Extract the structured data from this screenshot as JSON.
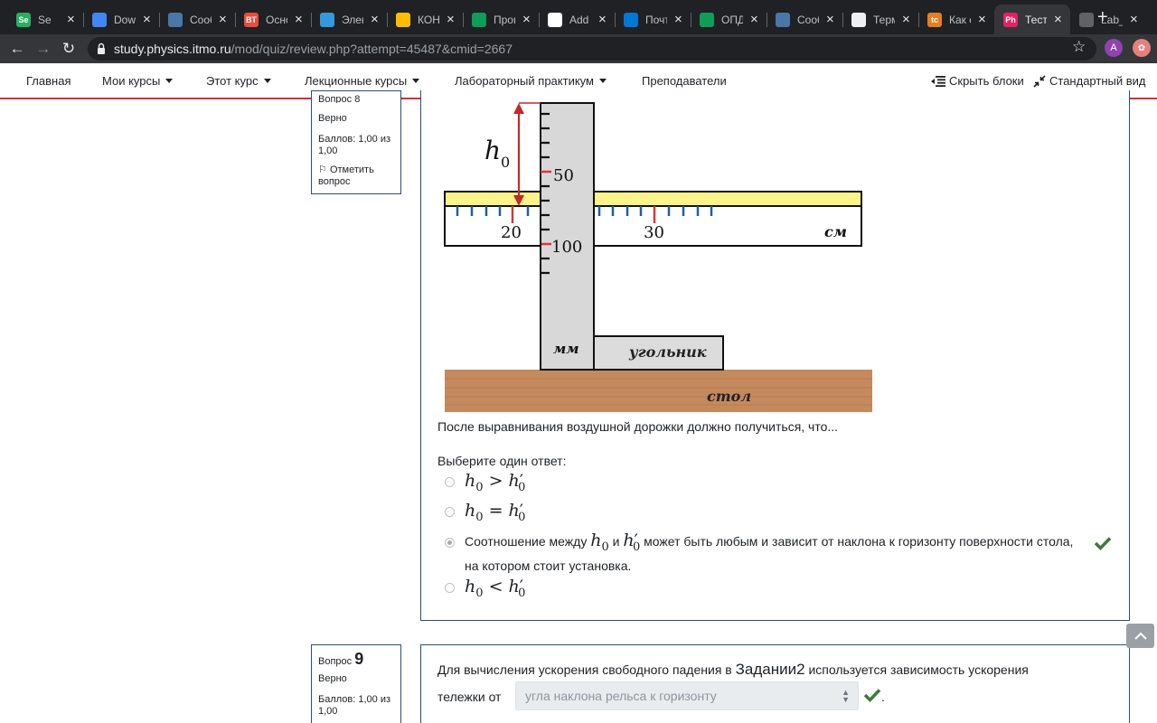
{
  "browser": {
    "tabs": [
      {
        "title": "Se",
        "favicon": "Se",
        "color": "#27ae60"
      },
      {
        "title": "Down",
        "favicon": "",
        "color": "#4285f4"
      },
      {
        "title": "Сооб",
        "favicon": "",
        "color": "#4a76a8"
      },
      {
        "title": "Осно",
        "favicon": "ВТ",
        "color": "#e74c3c"
      },
      {
        "title": "Элек",
        "favicon": "",
        "color": "#3498db"
      },
      {
        "title": "КОНС",
        "favicon": "",
        "color": "#fbbc04"
      },
      {
        "title": "Прог",
        "favicon": "",
        "color": "#0f9d58"
      },
      {
        "title": "Add F",
        "favicon": "",
        "color": "#ffffff"
      },
      {
        "title": "Почт",
        "favicon": "",
        "color": "#0078d4"
      },
      {
        "title": "ОПД",
        "favicon": "",
        "color": "#0f9d58"
      },
      {
        "title": "Сооб",
        "favicon": "",
        "color": "#4a76a8"
      },
      {
        "title": "Терм",
        "favicon": "",
        "color": "#ecf0f1"
      },
      {
        "title": "Как с",
        "favicon": "tc",
        "color": "#e67e22"
      },
      {
        "title": "Тест",
        "favicon": "Ph",
        "color": "#e91e63",
        "active": true
      },
      {
        "title": "Lab_",
        "favicon": "",
        "color": "#5f6368"
      }
    ],
    "url_host": "study.physics.itmo.ru",
    "url_path": "/mod/quiz/review.php?attempt=45487&cmid=2667",
    "profile_letter": "A"
  },
  "nav": {
    "items": [
      "Главная",
      "Мои курсы",
      "Этот курс",
      "Лекционные курсы",
      "Лабораторный практикум",
      "Преподаватели"
    ],
    "hide_blocks": "Скрыть блоки",
    "standard_view": "Стандартный вид"
  },
  "question8": {
    "number_partial": "Вопрос 8",
    "status": "Верно",
    "score": "Баллов: 1,00 из 1,00",
    "flag": "Отметить вопрос",
    "figure": {
      "h_label": "h",
      "h_sub": "0",
      "ruler_50": "50",
      "ruler_100": "100",
      "scale_20": "20",
      "scale_30": "30",
      "unit_cm": "см",
      "unit_mm": "мм",
      "square_label": "угольник",
      "table_label": "стол"
    },
    "prompt": "После выравнивания воздушной дорожки должно получиться, что...",
    "choose": "Выберите один ответ:",
    "options": {
      "a": "h0 > h′0",
      "b": "h0 = h′0",
      "c_pre": "Соотношение между",
      "c_and": "и",
      "c_post": "может быть любым и зависит от наклона к горизонту поверхности стола, на котором стоит установка.",
      "d": "h0 < h′0"
    },
    "math": {
      "h": "h",
      "sub0": "0",
      "prime": "′",
      "gt": ">",
      "eq": "=",
      "lt": "<"
    }
  },
  "question9": {
    "label": "Вопрос",
    "number": "9",
    "status": "Верно",
    "score": "Баллов: 1,00 из 1,00",
    "text_part1": "Для вычисления ускорения свободного падения в",
    "text_task": "Задании2",
    "text_part2": "используется зависимость ускорения",
    "text_line2": "тележки от",
    "selected": "угла наклона рельса к горизонту",
    "period": "."
  }
}
